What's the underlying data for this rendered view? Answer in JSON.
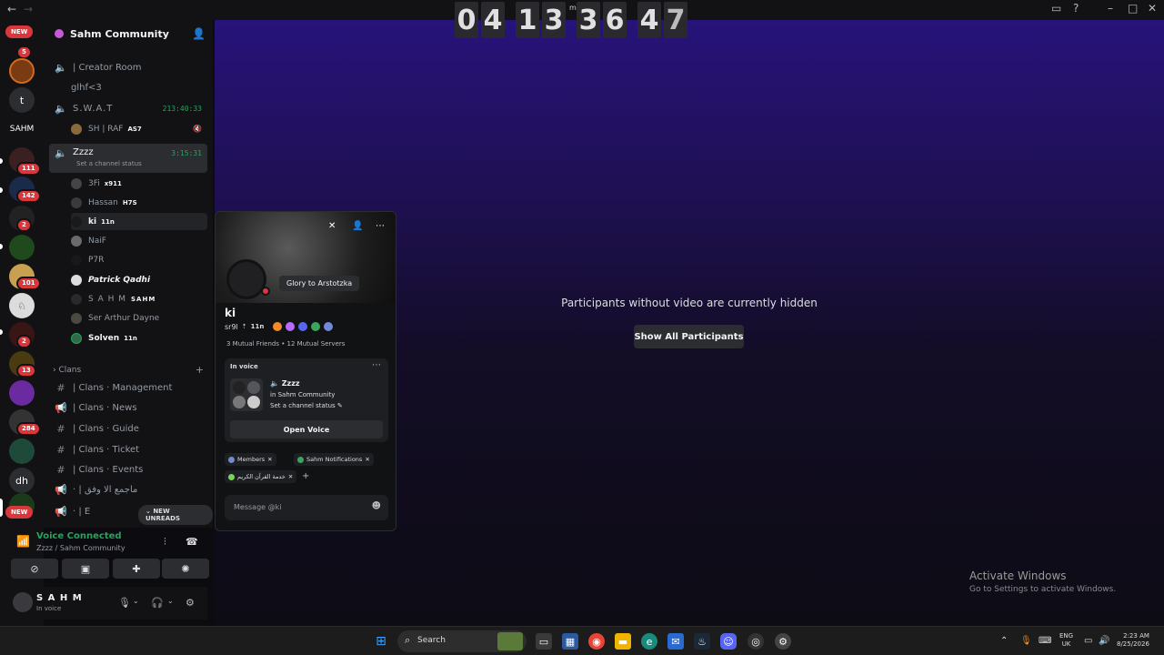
{
  "clock": {
    "digits": [
      "0",
      "4",
      "1",
      "3",
      "3",
      "6",
      "4",
      "7"
    ],
    "label": "m"
  },
  "server": {
    "name": "Sahm Community"
  },
  "rail": {
    "new_top": "NEW",
    "new_bottom": "NEW",
    "badges": [
      "5",
      "111",
      "142",
      "2",
      "101",
      "2",
      "13",
      "284"
    ],
    "servers": [
      {
        "label": "t",
        "color": "#2b2d31"
      },
      {
        "label": "SAHM",
        "color": "#121214"
      },
      {
        "label": "dh",
        "color": "#2b2d31"
      }
    ]
  },
  "channels": {
    "creator_room": "| Creator Room",
    "glhf": "glhf<3",
    "swat": "S.W.A.T",
    "swat_timer": "213:40:33",
    "zzzz": "Zzzz",
    "zzzz_timer": "3:15:31",
    "zzzz_status": "Set a channel status",
    "clans_cat": "Clans",
    "clans": [
      "| Clans · Management",
      "| Clans · News",
      "| Clans · Guide",
      "| Clans · Ticket",
      "| Clans · Events"
    ],
    "arabic1": "· | ماجمع الا وفق",
    "arabic2": "· | E",
    "new_unreads": "NEW UNREADS"
  },
  "swat_user": {
    "name": "SH | RAF",
    "tag": "AS7"
  },
  "voice_users": [
    {
      "name": "3Fi",
      "tag": "x911"
    },
    {
      "name": "Hassan",
      "tag": "H7S"
    },
    {
      "name": "ki",
      "tag": "11n"
    },
    {
      "name": "NaiF",
      "tag": ""
    },
    {
      "name": "P7R",
      "tag": ""
    },
    {
      "name": "Patrick Qadhi",
      "tag": ""
    },
    {
      "name": "S A H M",
      "tag": "SAHM"
    },
    {
      "name": "Ser Arthur Dayne",
      "tag": ""
    },
    {
      "name": "Solven",
      "tag": "11n"
    }
  ],
  "voice_panel": {
    "title": "Voice Connected",
    "sub": "Zzzz / Sahm Community"
  },
  "user_panel": {
    "name": "S A H M",
    "status": "In voice"
  },
  "stage": {
    "message": "Participants without video are currently hidden",
    "button": "Show All Participants"
  },
  "windows": {
    "line1": "Activate Windows",
    "line2": "Go to Settings to activate Windows."
  },
  "popout": {
    "tooltip": "Glory to Arstotzka",
    "name": "ki",
    "username": "sr9l",
    "tag": "11n",
    "mutual": "3 Mutual Friends • 12 Mutual Servers",
    "in_voice_label": "In voice",
    "voice_channel": "Zzzz",
    "voice_server": "in Sahm Community",
    "voice_status": "Set a channel status",
    "open_voice": "Open Voice",
    "roles": [
      "Members",
      "Sahm Notifications",
      "خدمة القرآن الكريم"
    ],
    "message_placeholder": "Message @ki"
  },
  "taskbar": {
    "search": "Search",
    "lang1": "ENG",
    "lang2": "UK",
    "time": "2:23 AM",
    "date": "8/25/2026"
  }
}
